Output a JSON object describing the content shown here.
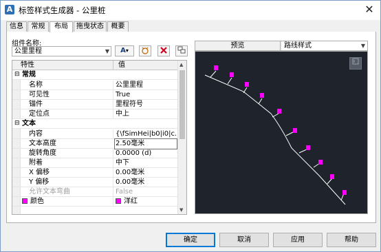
{
  "window": {
    "title": "标签样式生成器 - 公里桩",
    "close_glyph": "✕"
  },
  "tabs": [
    "信息",
    "常规",
    "布局",
    "拖曳状态",
    "概要"
  ],
  "active_tab": "布局",
  "component": {
    "label": "组件名称:",
    "value": "公里里程"
  },
  "toolbar": {
    "text_btn": "A",
    "drop": "▾"
  },
  "grid": {
    "headers": {
      "property": "特性",
      "value": "值"
    },
    "categories": {
      "general": "常规",
      "text": "文本"
    },
    "rows": {
      "name": {
        "label": "名称",
        "value": "公里里程"
      },
      "visible": {
        "label": "可见性",
        "value": "True"
      },
      "anchor_comp": {
        "label": "锚件",
        "value": "里程符号"
      },
      "anchor_point": {
        "label": "定位点",
        "value": "中上"
      },
      "content": {
        "label": "内容",
        "value": "{\\fSimHei|b0|i0|c..."
      },
      "text_height": {
        "label": "文本高度",
        "value": "2.50毫米"
      },
      "rotation": {
        "label": "旋转角度",
        "value": "0.0000 (d)"
      },
      "attachment": {
        "label": "附着",
        "value": "中下"
      },
      "x_offset": {
        "label": "X 偏移",
        "value": "0.00毫米"
      },
      "y_offset": {
        "label": "Y 偏移",
        "value": "0.00毫米"
      },
      "curved": {
        "label": "允许文本弯曲",
        "value": "False"
      },
      "color": {
        "label": "颜色",
        "value": "洋红"
      }
    }
  },
  "preview": {
    "label": "预览",
    "style": "路线样式"
  },
  "buttons": {
    "ok": "确定",
    "cancel": "取消",
    "apply": "应用",
    "help": "帮助"
  },
  "colors": {
    "accent": "#0078d7",
    "marker": "#ff00ff",
    "canvas_bg": "#1f232b"
  }
}
